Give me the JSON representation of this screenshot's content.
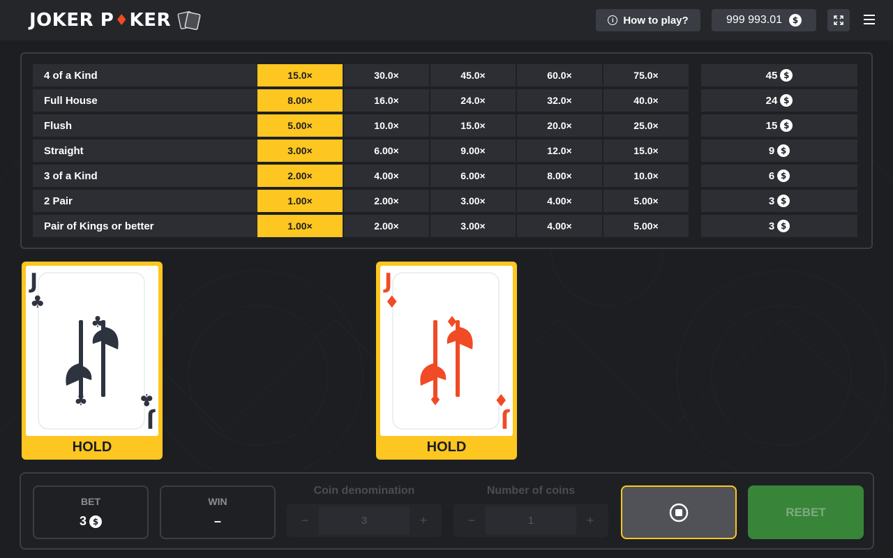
{
  "header": {
    "logo_left": "JOKER P",
    "logo_diamond": "♦",
    "logo_right": "KER",
    "how_to_play": "How to play?",
    "balance": "999 993.01",
    "coin_symbol": "$"
  },
  "paytable": {
    "rows": [
      {
        "name": "4 of a Kind",
        "multipliers": [
          "15.0×",
          "30.0×",
          "45.0×",
          "60.0×",
          "75.0×"
        ],
        "payout": "45"
      },
      {
        "name": "Full House",
        "multipliers": [
          "8.00×",
          "16.0×",
          "24.0×",
          "32.0×",
          "40.0×"
        ],
        "payout": "24"
      },
      {
        "name": "Flush",
        "multipliers": [
          "5.00×",
          "10.0×",
          "15.0×",
          "20.0×",
          "25.0×"
        ],
        "payout": "15"
      },
      {
        "name": "Straight",
        "multipliers": [
          "3.00×",
          "6.00×",
          "9.00×",
          "12.0×",
          "15.0×"
        ],
        "payout": "9"
      },
      {
        "name": "3 of a Kind",
        "multipliers": [
          "2.00×",
          "4.00×",
          "6.00×",
          "8.00×",
          "10.0×"
        ],
        "payout": "6"
      },
      {
        "name": "2 Pair",
        "multipliers": [
          "1.00×",
          "2.00×",
          "3.00×",
          "4.00×",
          "5.00×"
        ],
        "payout": "3"
      },
      {
        "name": "Pair of Kings or better",
        "multipliers": [
          "1.00×",
          "2.00×",
          "3.00×",
          "4.00×",
          "5.00×"
        ],
        "payout": "3"
      }
    ],
    "active_column": 0
  },
  "cards": [
    {
      "rank": "J",
      "suit": "clubs",
      "suit_symbol": "♣",
      "color": "#2d3440",
      "hold_label": "HOLD",
      "held": true
    },
    {
      "rank": "J",
      "suit": "diamonds",
      "suit_symbol": "♦",
      "color": "#f04b25",
      "hold_label": "HOLD",
      "held": true
    }
  ],
  "controls": {
    "bet_label": "BET",
    "bet_value": "3",
    "win_label": "WIN",
    "win_value": "–",
    "coin_denomination_label": "Coin denomination",
    "coin_denomination_value": "3",
    "number_of_coins_label": "Number of coins",
    "number_of_coins_value": "1",
    "minus": "−",
    "plus": "+",
    "rebet_label": "REBET"
  },
  "colors": {
    "accent": "#fdc620",
    "red_suit": "#f04b25",
    "dark_suit": "#2d3440",
    "rebet_green": "#38853a",
    "background": "#1c1e22"
  }
}
